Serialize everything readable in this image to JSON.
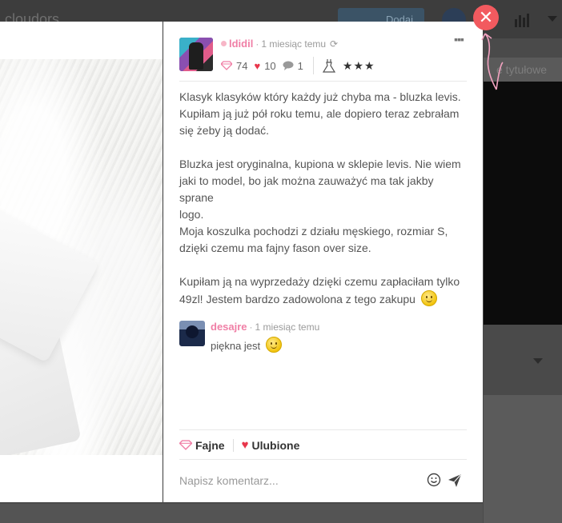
{
  "background": {
    "logo_text": "cloudors",
    "top_button_label": "Dodaj",
    "search_placeholder": "e tytułowe"
  },
  "post": {
    "author": "ldidil",
    "time": "1 miesiąc temu",
    "stats": {
      "fajne": "74",
      "ulubione": "10",
      "comments": "1"
    },
    "paragraphs": [
      [
        "Klasyk klasyków który każdy już chyba ma - bluzka levis.",
        "Kupiłam ją już pół roku temu, ale dopiero teraz zebrałam",
        "się żeby ją dodać."
      ],
      [
        "Bluzka jest oryginalna, kupiona w sklepie levis. Nie wiem",
        "jaki to model, bo jak można zauważyć ma tak jakby sprane",
        "logo.",
        "Moja koszulka pochodzi z działu męskiego, rozmiar S,",
        "dzięki czemu ma fajny fason over size."
      ],
      [
        "Kupiłam ją na wyprzedaży dzięki czemu zapłaciłam tylko",
        "49zl! Jestem bardzo zadowolona z tego zakupu"
      ]
    ]
  },
  "comment": {
    "author": "desajre",
    "time": "1 miesiąc temu",
    "text": "piękna jest"
  },
  "actions": {
    "fajne_label": "Fajne",
    "ulubione_label": "Ulubione"
  },
  "comment_input": {
    "placeholder": "Napisz komentarz..."
  },
  "colors": {
    "accent_pink": "#f07fa6",
    "heart_red": "#e8364b",
    "close_red": "#f25a5f"
  }
}
